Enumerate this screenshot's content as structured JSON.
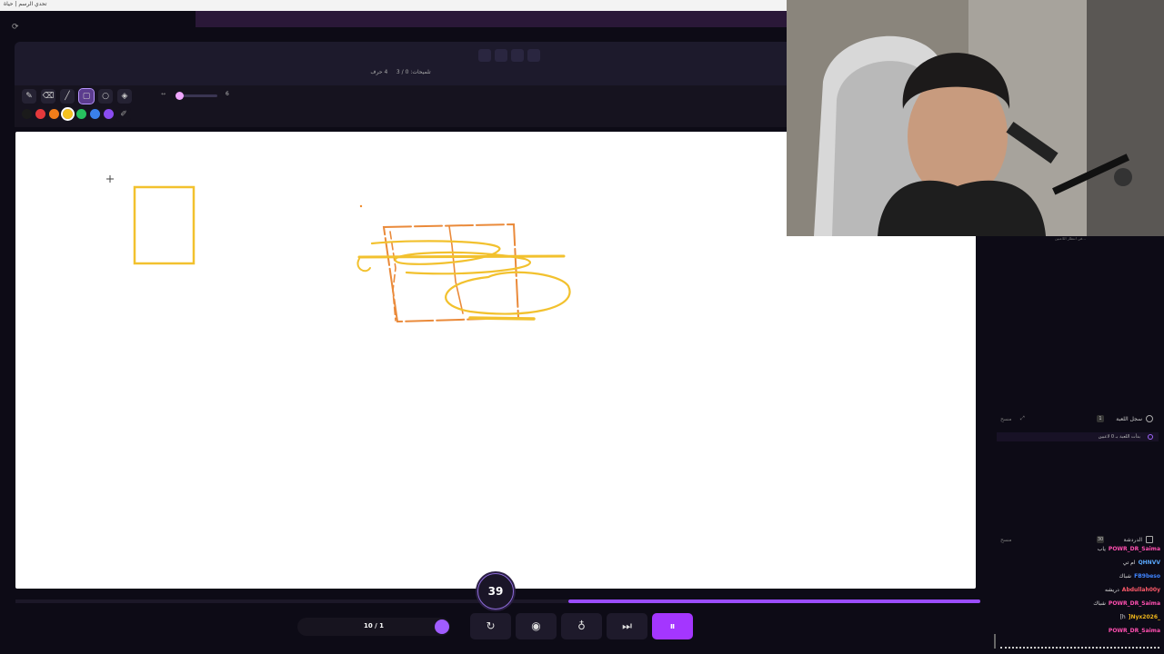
{
  "window": {
    "title": "تحدي الرسم | حياة"
  },
  "header": {
    "letters": "4 حرف",
    "hints": "تلميحات: 0 / 3"
  },
  "toolbar": {
    "tools": [
      "pen-icon",
      "eraser-icon",
      "line-icon",
      "rectangle-icon",
      "circle-icon",
      "fill-icon"
    ],
    "active_tool": "rectangle-icon",
    "brush_size": "6",
    "brush_size_percent": 0,
    "colors": [
      "#1a1a1a",
      "#e5393c",
      "#f07d1a",
      "#f5c220",
      "#27c25f",
      "#3a80ea",
      "#8a4cf0"
    ],
    "active_color": "#f5c220"
  },
  "side": {
    "game_log": {
      "title": "سجل اللعبة",
      "count": "1",
      "clear": "مسح",
      "entry": "بدأت اللعبة بـ 0 لاعبين"
    },
    "chat": {
      "title": "الدردشة",
      "count": "30",
      "clear": "مسح"
    },
    "webcam_caption": "في انتظار اللاعبين..."
  },
  "chat_messages": [
    {
      "user": "POWR_DR_Saima",
      "message": "ياب",
      "color": "#ff4fb0"
    },
    {
      "user": "QHNVV",
      "message": "ام تي",
      "color": "#5aa9ff"
    },
    {
      "user": "FB9beso",
      "message": "شباك",
      "color": "#3f84ff"
    },
    {
      "user": "Abdullah00y",
      "message": "دريشه",
      "color": "#ff5a6a"
    },
    {
      "user": "POWR_DR_Saima",
      "message": "شباك",
      "color": "#ff4fb0"
    },
    {
      "user": "]Nyx2026_",
      "message": "[h",
      "color": "#f0b61a"
    },
    {
      "user": "POWR_DR_Saima",
      "message": "",
      "color": "#ff4fb0"
    }
  ],
  "timer": {
    "seconds": "39"
  },
  "progress": {
    "fraction": 0.43
  },
  "round": {
    "label": "10 / 1"
  },
  "controls": [
    "restart-icon",
    "eye-icon",
    "hint-icon",
    "skip-icon",
    "pause-icon"
  ]
}
